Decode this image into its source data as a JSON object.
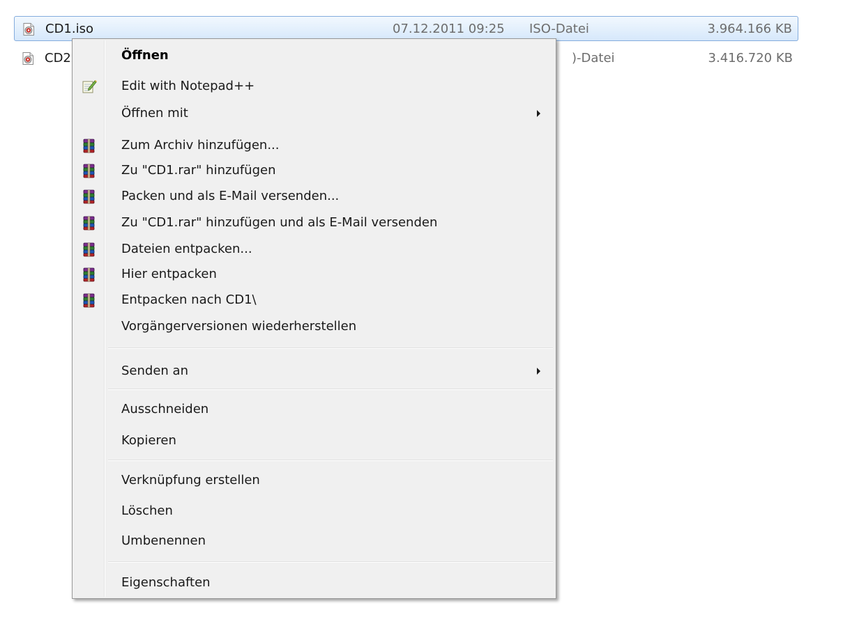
{
  "files": [
    {
      "name": "CD1.iso",
      "date": "07.12.2011 09:25",
      "type": "ISO-Datei",
      "size": "3.964.166 KB",
      "icon": "iso-file-icon"
    },
    {
      "name": "CD2",
      "date": "",
      "type": ")-Datei",
      "size": "3.416.720 KB",
      "icon": "iso-file-icon"
    }
  ],
  "menu": {
    "items": [
      {
        "label": "Öffnen"
      },
      {
        "label": "Edit with Notepad++",
        "icon": "notepad-plus-plus-icon"
      },
      {
        "label": "Öffnen mit"
      },
      {
        "label": "Zum Archiv hinzufügen...",
        "icon": "winrar-icon"
      },
      {
        "label": "Zu \"CD1.rar\" hinzufügen",
        "icon": "winrar-icon"
      },
      {
        "label": "Packen und als E-Mail versenden...",
        "icon": "winrar-icon"
      },
      {
        "label": "Zu \"CD1.rar\" hinzufügen und als E-Mail versenden",
        "icon": "winrar-icon"
      },
      {
        "label": "Dateien entpacken...",
        "icon": "winrar-icon"
      },
      {
        "label": "Hier entpacken",
        "icon": "winrar-icon"
      },
      {
        "label": "Entpacken nach CD1\\",
        "icon": "winrar-icon"
      },
      {
        "label": "Vorgängerversionen wiederherstellen"
      },
      {
        "label": "Senden an"
      },
      {
        "label": "Ausschneiden"
      },
      {
        "label": "Kopieren"
      },
      {
        "label": "Verknüpfung erstellen"
      },
      {
        "label": "Löschen"
      },
      {
        "label": "Umbenennen"
      },
      {
        "label": "Eigenschaften"
      }
    ]
  },
  "colors": {
    "selection_border": "#84acdd",
    "menu_background": "#f0f0f0",
    "menu_border": "#979797"
  }
}
